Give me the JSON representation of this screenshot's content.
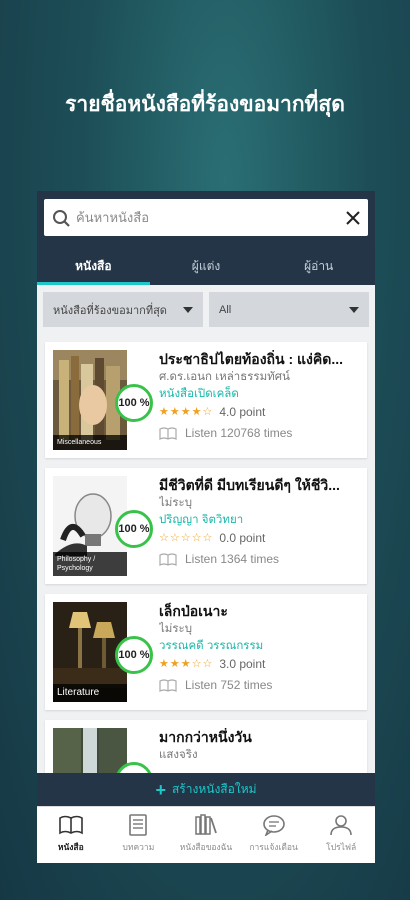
{
  "headline": "รายชื่อหนังสือที่ร้องขอมากที่สุด",
  "search": {
    "placeholder": "ค้นหาหนังสือ"
  },
  "tabs": [
    {
      "label": "หนังสือ",
      "active": true
    },
    {
      "label": "ผู้แต่ง",
      "active": false
    },
    {
      "label": "ผู้อ่าน",
      "active": false
    }
  ],
  "filters": {
    "sort": "หนังสือที่ร้องขอมากที่สุด",
    "category": "All"
  },
  "books": [
    {
      "title": "ประชาธิปไตยท้องถิ่น : แง่คิด...",
      "author": "ศ.ดร.เอนก เหล่าธรรมทัศน์",
      "publisher": "หนังสือเปิดเคล็ด",
      "rating_text": "4.0 point",
      "rating": 4,
      "listen": "Listen 120768 times",
      "progress": "100 %",
      "cover_label": "Miscellaneous"
    },
    {
      "title": "มีชีวิตที่ดี มีบทเรียนดีๆ ให้ชีวิ...",
      "author": "ไม่ระบุ",
      "publisher": "ปริญญา จิตวิทยา",
      "rating_text": "0.0 point",
      "rating": 0,
      "listen": "Listen 1364 times",
      "progress": "100 %",
      "cover_label": "Philosophy / Psychology"
    },
    {
      "title": "เล็กป่อเนาะ",
      "author": "ไม่ระบุ",
      "publisher": "วรรณคดี วรรณกรรม",
      "rating_text": "3.0 point",
      "rating": 3,
      "listen": "Listen 752 times",
      "progress": "100 %",
      "cover_label": "Literature"
    },
    {
      "title": "มากกว่าหนึ่งวัน",
      "author": "แสงจริง",
      "publisher": "",
      "rating_text": "",
      "rating": 0,
      "listen": "",
      "progress": "",
      "cover_label": ""
    }
  ],
  "create_button": "สร้างหนังสือใหม่",
  "nav": [
    {
      "label": "หนังสือ",
      "icon": "book-open-icon",
      "active": true
    },
    {
      "label": "บทความ",
      "icon": "document-icon",
      "active": false
    },
    {
      "label": "หนังสือของฉัน",
      "icon": "bookshelf-icon",
      "active": false
    },
    {
      "label": "การแจ้งเตือน",
      "icon": "chat-bubble-icon",
      "active": false
    },
    {
      "label": "โปรไฟล์",
      "icon": "user-icon",
      "active": false
    }
  ],
  "colors": {
    "accent": "#1ec8c9",
    "header": "#243547",
    "badge": "#39c24a",
    "star": "#f0a020",
    "publisher": "#19b7a9"
  }
}
